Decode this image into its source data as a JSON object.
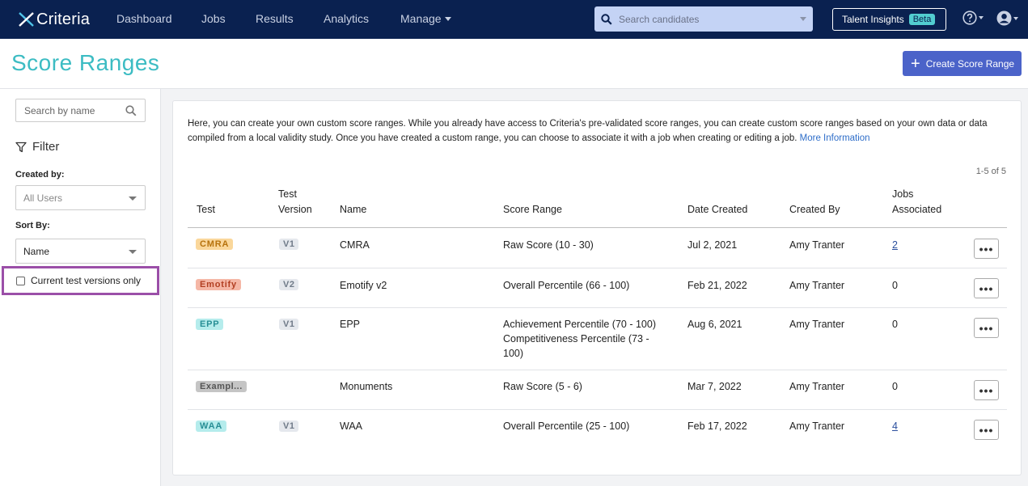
{
  "nav": {
    "logo_text": "Criteria",
    "items": [
      "Dashboard",
      "Jobs",
      "Results",
      "Analytics",
      "Manage"
    ],
    "search_placeholder": "Search candidates",
    "talent_insights": "Talent Insights",
    "beta": "Beta"
  },
  "header": {
    "title": "Score Ranges",
    "create_button": "Create Score Range"
  },
  "sidebar": {
    "search_placeholder": "Search by name",
    "filter_label": "Filter",
    "created_by_label": "Created by:",
    "created_by_value": "All Users",
    "sort_by_label": "Sort By:",
    "sort_by_value": "Name",
    "checkbox_label": "Current test versions only"
  },
  "main": {
    "intro": "Here, you can create your own custom score ranges. While you already have access to Criteria's pre-validated score ranges, you can create custom score ranges based on your own data or data compiled from a local validity study. Once you have created a custom range, you can choose to associate it with a job when creating or editing a job.",
    "more_info": "More Information",
    "count": "1-5 of 5",
    "columns": {
      "test": "Test",
      "version_1": "Test",
      "version_2": "Version",
      "name": "Name",
      "score_range": "Score Range",
      "date_created": "Date Created",
      "created_by": "Created By",
      "jobs_1": "Jobs",
      "jobs_2": "Associated"
    },
    "rows": [
      {
        "test": "CMRA",
        "version": "V1",
        "name": "CMRA",
        "range_1": "Raw Score (10 - 30)",
        "range_2": "",
        "range_3": "",
        "range_4": "",
        "date": "Jul 2, 2021",
        "by": "Amy Tranter",
        "jobs": "2"
      },
      {
        "test": "Emotify",
        "version": "V2",
        "name": "Emotify v2",
        "range_1": "Overall Percentile (66 - 100)",
        "range_2": "",
        "range_3": "",
        "range_4": "",
        "date": "Feb 21, 2022",
        "by": "Amy Tranter",
        "jobs": "0"
      },
      {
        "test": "EPP",
        "version": "V1",
        "name": "EPP",
        "range_1": "Achievement Percentile (70 - 100)",
        "range_2": "Competitiveness Percentile (73 -",
        "range_3": "100)",
        "range_4": "",
        "date": "Aug 6, 2021",
        "by": "Amy Tranter",
        "jobs": "0"
      },
      {
        "test": "Exampl...",
        "version": "",
        "name": "Monuments",
        "range_1": "Raw Score (5 - 6)",
        "range_2": "",
        "range_3": "",
        "range_4": "",
        "date": "Mar 7, 2022",
        "by": "Amy Tranter",
        "jobs": "0"
      },
      {
        "test": "WAA",
        "version": "V1",
        "name": "WAA",
        "range_1": "Overall Percentile (25 - 100)",
        "range_2": "",
        "range_3": "",
        "range_4": "",
        "date": "Feb 17, 2022",
        "by": "Amy Tranter",
        "jobs": "4"
      }
    ],
    "more_button": "•••"
  }
}
